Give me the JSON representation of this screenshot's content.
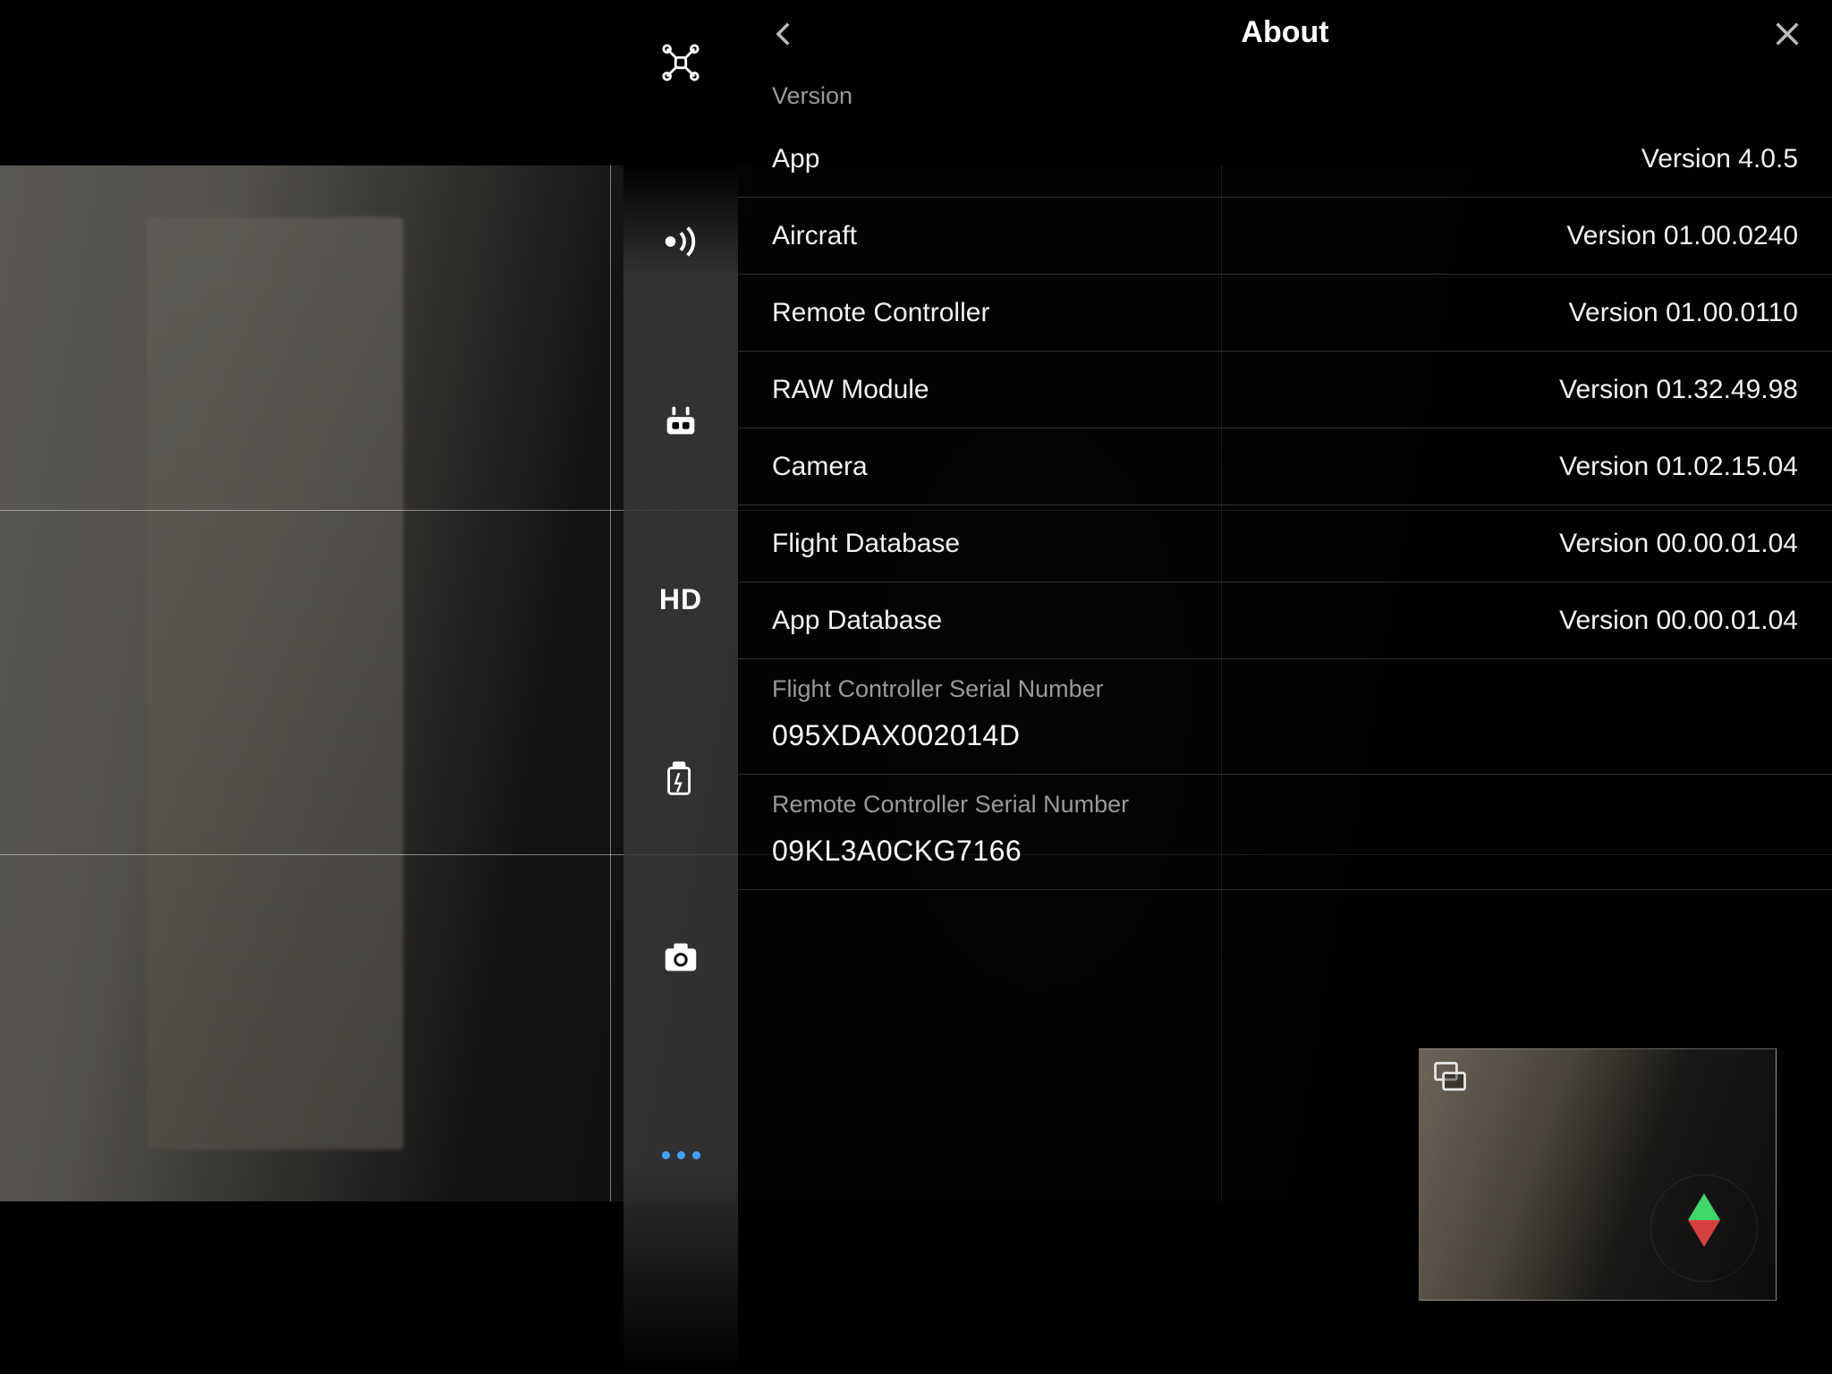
{
  "panel": {
    "title": "About",
    "section_version_label": "Version",
    "rows": [
      {
        "label": "App",
        "value": "Version 4.0.5"
      },
      {
        "label": "Aircraft",
        "value": "Version 01.00.0240"
      },
      {
        "label": "Remote Controller",
        "value": "Version 01.00.0110"
      },
      {
        "label": "RAW Module",
        "value": "Version 01.32.49.98"
      },
      {
        "label": "Camera",
        "value": "Version 01.02.15.04"
      },
      {
        "label": "Flight Database",
        "value": "Version 00.00.01.04"
      },
      {
        "label": "App Database",
        "value": "Version 00.00.01.04"
      }
    ],
    "serials": [
      {
        "label": "Flight Controller Serial Number",
        "value": "095XDAX002014D"
      },
      {
        "label": "Remote Controller Serial Number",
        "value": "09KL3A0CKG7166"
      }
    ]
  },
  "tabs": {
    "icons": [
      "drone",
      "signal",
      "controller",
      "hd",
      "battery",
      "camera",
      "more"
    ]
  }
}
